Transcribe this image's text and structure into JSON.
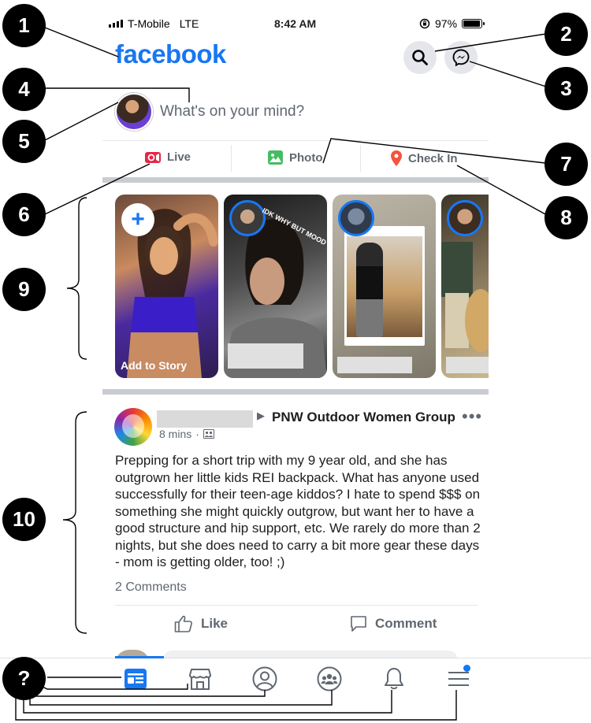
{
  "status_bar": {
    "carrier": "T-Mobile",
    "network": "LTE",
    "time": "8:42 AM",
    "battery": "97%",
    "battery_level": 0.97
  },
  "header": {
    "logo": "facebook",
    "search_icon": "search-icon",
    "messenger_icon": "messenger-icon"
  },
  "composer": {
    "prompt": "What's on your mind?"
  },
  "actions": {
    "live": "Live",
    "photo": "Photo",
    "checkin": "Check In"
  },
  "stories": {
    "add_label": "Add to Story",
    "story2_caption": "IDK WHY BUT MOOD"
  },
  "post": {
    "group": "PNW Outdoor Women Group",
    "time": "8 mins",
    "text": "Prepping for a short trip with my 9 year old, and she has outgrown her little kids REI backpack. What has anyone used successfully for their teen-age kiddos? I hate to spend $$$ on something she might quickly outgrow, but want her to have a good structure and hip support, etc. We rarely do more than 2 nights, but she does need to carry a bit more gear these days - mom is getting older, too! ;)",
    "comments": "2 Comments",
    "like": "Like",
    "comment": "Comment"
  },
  "nav": [
    "home-icon",
    "marketplace-icon",
    "profile-icon",
    "groups-icon",
    "notifications-icon",
    "menu-icon"
  ],
  "annotations": [
    "1",
    "2",
    "3",
    "4",
    "5",
    "6",
    "7",
    "8",
    "9",
    "10",
    "?"
  ],
  "colors": {
    "brand": "#1877f2",
    "live": "#e42645",
    "photo": "#45bd62",
    "checkin": "#f5533d"
  }
}
